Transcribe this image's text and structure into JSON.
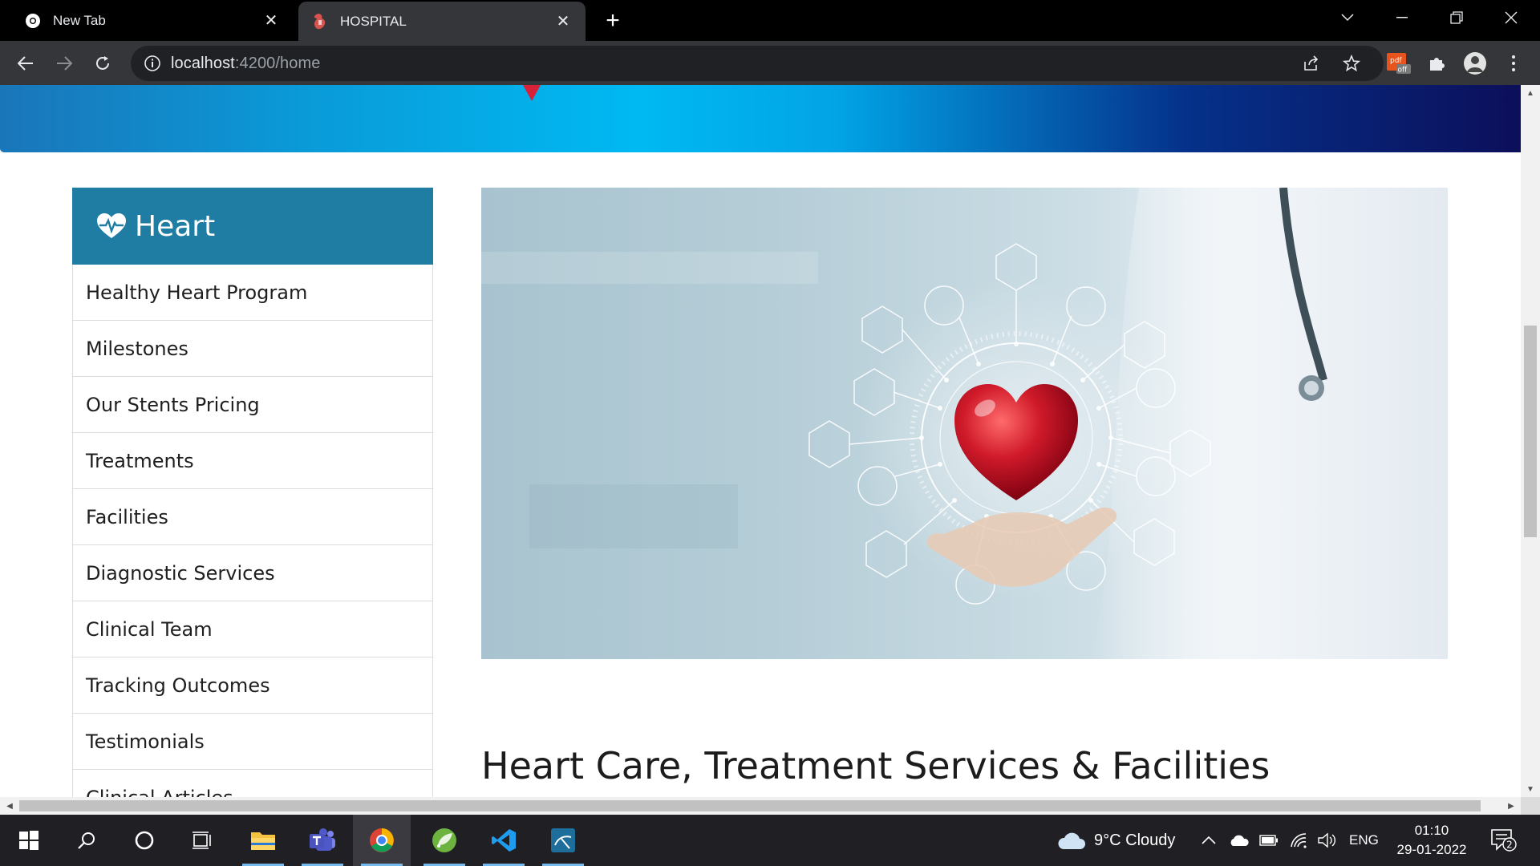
{
  "browser": {
    "tabs": [
      {
        "title": "New Tab",
        "active": false
      },
      {
        "title": "HOSPITAL",
        "active": true
      }
    ],
    "url_host": "localhost",
    "url_rest": ":4200/home",
    "ext_badge": "off"
  },
  "sidebar": {
    "title": "Heart",
    "items": [
      "Healthy Heart Program",
      "Milestones",
      "Our Stents Pricing",
      "Treatments",
      "Facilities",
      "Diagnostic Services",
      "Clinical Team",
      "Tracking Outcomes",
      "Testimonials",
      "Clinical Articles"
    ]
  },
  "main": {
    "headline": "Heart Care, Treatment Services & Facilities"
  },
  "taskbar": {
    "weather": "9°C  Cloudy",
    "language": "ENG",
    "time": "01:10",
    "date": "29-01-2022",
    "notification_count": "2"
  },
  "colors": {
    "sidebar_header": "#1f7ca3",
    "banner_marker": "#d9213a",
    "heart": "#c8102e"
  }
}
